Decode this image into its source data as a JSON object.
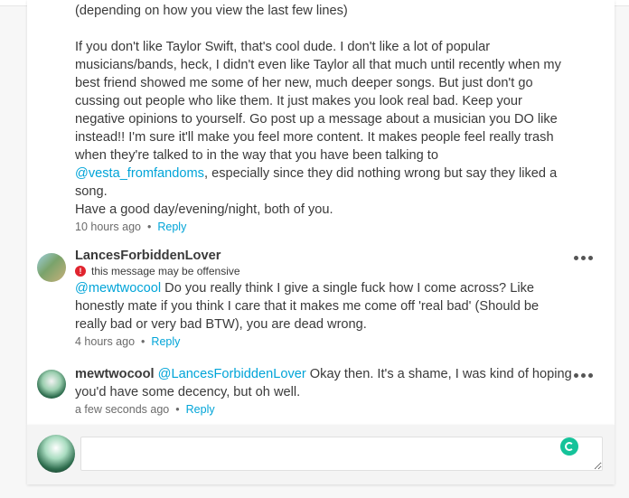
{
  "comments": [
    {
      "line_partial": "(depending on how you view the last few lines)",
      "paragraph": "If you don't like Taylor Swift, that's cool dude. I don't like a lot of popular musicians/bands, heck, I didn't even like Taylor all that much until recently when my best friend showed me some of her new, much deeper songs. But just don't go cussing out people who like them. It just makes you look real bad. Keep your negative opinions to yourself. Go post up a message about a musician you DO like instead!! I'm sure it'll make you feel more content. It makes people feel really trash when they're talked to in the way that you have been talking to",
      "mention": "@vesta_fromfandoms",
      "mention_suffix": ", especially since they did nothing wrong but say they liked a song.",
      "closing": "Have a good day/evening/night, both of you.",
      "time": "10 hours ago",
      "reply": "Reply"
    },
    {
      "username": "LancesForbiddenLover",
      "warning": "this message may be offensive",
      "mention": "@mewtwocool",
      "body": " Do you really think I give a single fuck how I come across? Like honestly mate if you think I care that it makes me come off 'real bad' (Should be really bad or very bad BTW), you are dead wrong.",
      "time": "4 hours ago",
      "reply": "Reply"
    },
    {
      "username": "mewtwocool",
      "mention": "@LancesForbiddenLover",
      "body": " Okay then. It's a shame, I was kind of hoping you'd have some decency, but oh well.",
      "time": "a few seconds ago",
      "reply": "Reply"
    }
  ],
  "composer": {
    "placeholder": ""
  },
  "icons": {
    "more": "more-options-icon",
    "warning": "warning-icon",
    "grammarly": "grammarly-icon"
  },
  "colors": {
    "link": "#00a4d8",
    "warning": "#e0242e",
    "grammarly": "#15c39a"
  }
}
